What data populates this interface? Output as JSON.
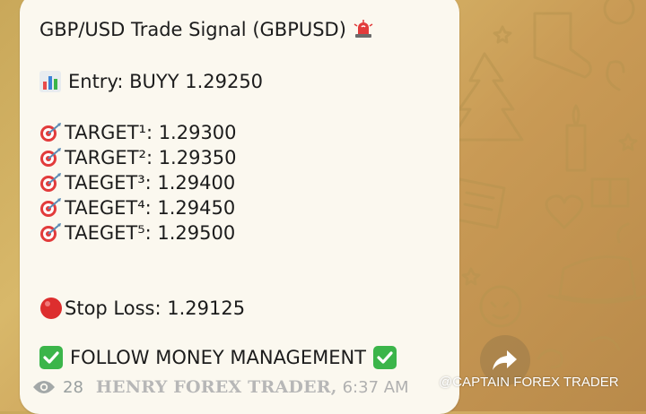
{
  "message": {
    "title": "GBP/USD Trade Signal (GBPUSD)",
    "entry": "Entry: BUYY 1.29250",
    "targets": [
      "TARGET¹: 1.29300",
      "TARGET²: 1.29350",
      "TAEGET³: 1.29400",
      "TAEGET⁴: 1.29450",
      "TAEGET⁵: 1.29500"
    ],
    "stop_loss": "Stop Loss: 1.29125",
    "follow": "FOLLOW MONEY MANAGEMENT"
  },
  "footer": {
    "views": "28",
    "signature": "HENRY FOREX TRADER,",
    "time": "6:37 AM"
  },
  "watermark": "@CAPTAIN FOREX TRADER",
  "icons": {
    "title": "siren-icon",
    "entry": "bar-chart-icon",
    "target": "dart-target-icon",
    "stop": "red-circle-icon",
    "follow": "check-mark-icon",
    "views": "eye-icon",
    "share": "share-arrow-icon"
  },
  "colors": {
    "bubble": "#fbf8ef",
    "text": "#1c1c1c",
    "check": "#3bb54a",
    "stop": "#dd2e2e"
  }
}
